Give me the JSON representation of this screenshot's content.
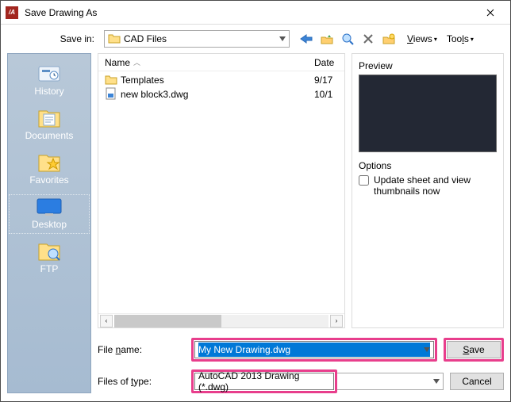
{
  "window": {
    "title": "Save Drawing As"
  },
  "savein": {
    "label": "Save in:",
    "value": "CAD Files"
  },
  "menus": {
    "views": "Views",
    "tools": "Tools"
  },
  "places": {
    "history": "History",
    "documents": "Documents",
    "favorites": "Favorites",
    "desktop": "Desktop",
    "ftp": "FTP"
  },
  "columns": {
    "name": "Name",
    "date": "Date"
  },
  "files": [
    {
      "icon": "folder",
      "name": "Templates",
      "date": "9/17"
    },
    {
      "icon": "dwg",
      "name": "new block3.dwg",
      "date": "10/1"
    }
  ],
  "preview": {
    "label": "Preview"
  },
  "options": {
    "label": "Options",
    "checkbox": "Update sheet and view thumbnails now",
    "checked": false
  },
  "filename": {
    "label": "File name:",
    "value": "My New Drawing.dwg"
  },
  "filetype": {
    "label": "Files of type:",
    "value": "AutoCAD 2013 Drawing (*.dwg)"
  },
  "buttons": {
    "save": "Save",
    "cancel": "Cancel"
  },
  "colors": {
    "highlight": "#e83e8c"
  }
}
